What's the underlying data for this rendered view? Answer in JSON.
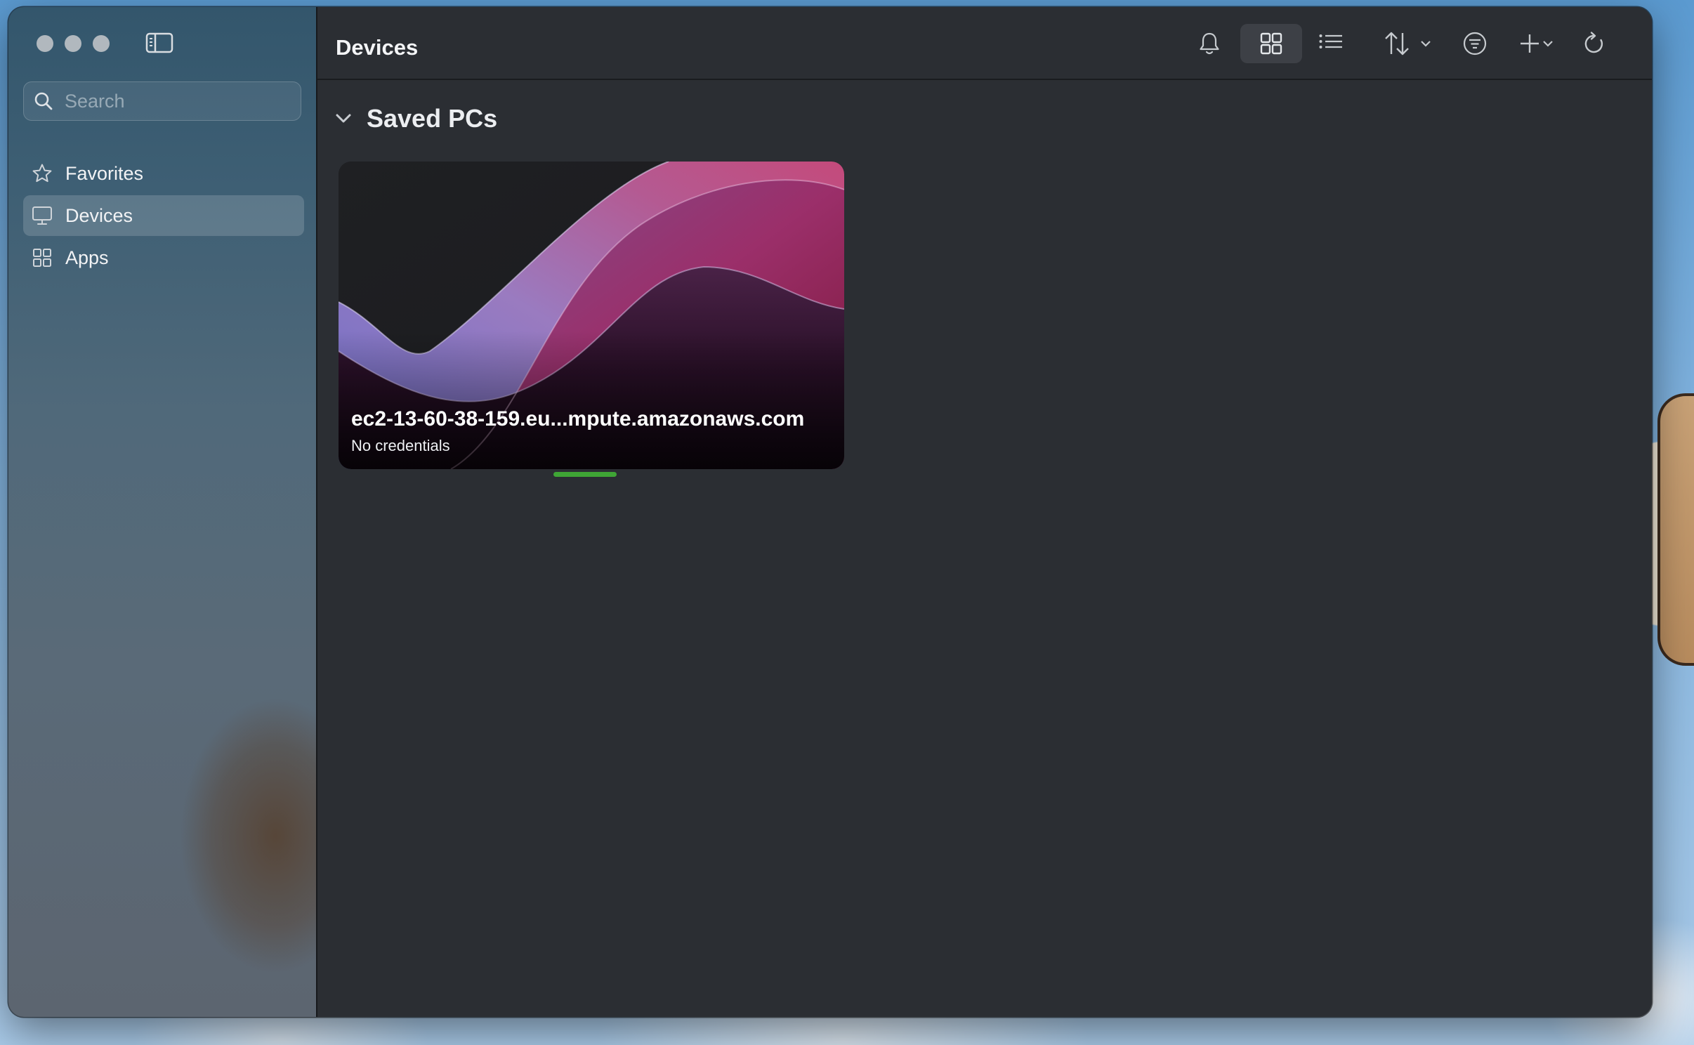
{
  "window": {
    "title": "Devices"
  },
  "sidebar": {
    "search_placeholder": "Search",
    "items": [
      {
        "label": "Favorites",
        "icon": "star-icon",
        "selected": false
      },
      {
        "label": "Devices",
        "icon": "monitor-icon",
        "selected": true
      },
      {
        "label": "Apps",
        "icon": "apps-grid-icon",
        "selected": false
      }
    ]
  },
  "toolbar": {
    "icons": [
      "bell-icon",
      "grid-view-icon",
      "list-view-icon",
      "sort-icon",
      "filter-icon",
      "add-icon",
      "refresh-icon"
    ],
    "active_view": "grid"
  },
  "section": {
    "title": "Saved PCs",
    "expanded": true
  },
  "devices": [
    {
      "name": "ec2-13-60-38-159.eu...mpute.amazonaws.com",
      "status": "No credentials",
      "connection_color": "#3fa535"
    }
  ],
  "colors": {
    "accent_green": "#3fa535",
    "window_bg": "#2b2e33"
  }
}
